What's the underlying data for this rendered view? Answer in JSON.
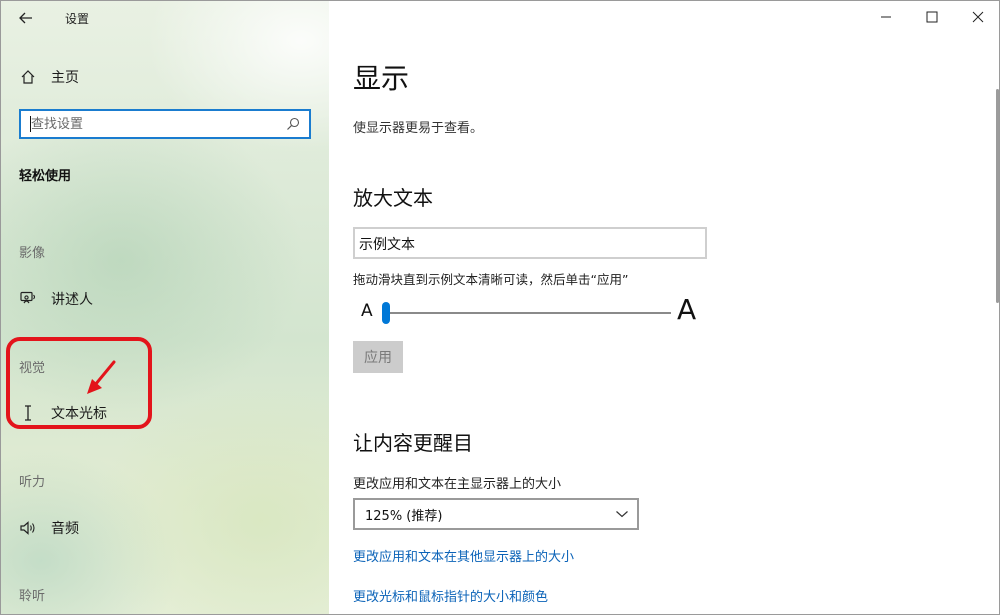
{
  "window": {
    "title": "设置",
    "controls": {
      "minimize": "—",
      "maximize": "☐",
      "close": "✕"
    }
  },
  "sidebar": {
    "home_label": "主页",
    "search": {
      "placeholder": "查找设置",
      "value": ""
    },
    "category_title": "轻松使用",
    "groups": [
      {
        "label": "影像",
        "items": [
          {
            "label": "讲述人",
            "icon": "narrator-icon"
          }
        ]
      },
      {
        "label": "视觉",
        "items": [
          {
            "label": "文本光标",
            "icon": "text-cursor-icon"
          }
        ]
      },
      {
        "label": "听力",
        "items": [
          {
            "label": "音频",
            "icon": "speaker-icon"
          }
        ]
      },
      {
        "label": "聆听",
        "items": []
      }
    ],
    "highlight_color": "#e3141b"
  },
  "main": {
    "page_title": "显示",
    "page_description": "使显示器更易于查看。",
    "enlarge_text": {
      "heading": "放大文本",
      "sample_text": "示例文本",
      "instruction": "拖动滑块直到示例文本清晰可读，然后单击“应用”",
      "small_a": "A",
      "large_a": "A",
      "slider_level": 0.0,
      "apply_label": "应用"
    },
    "emphasis": {
      "heading": "让内容更醒目",
      "scale_label": "更改应用和文本在主显示器上的大小",
      "scale_value": "125% (推荐)",
      "links": [
        "更改应用和文本在其他显示器上的大小",
        "更改光标和鼠标指针的大小和颜色"
      ]
    },
    "accent_color": "#0078d7"
  }
}
